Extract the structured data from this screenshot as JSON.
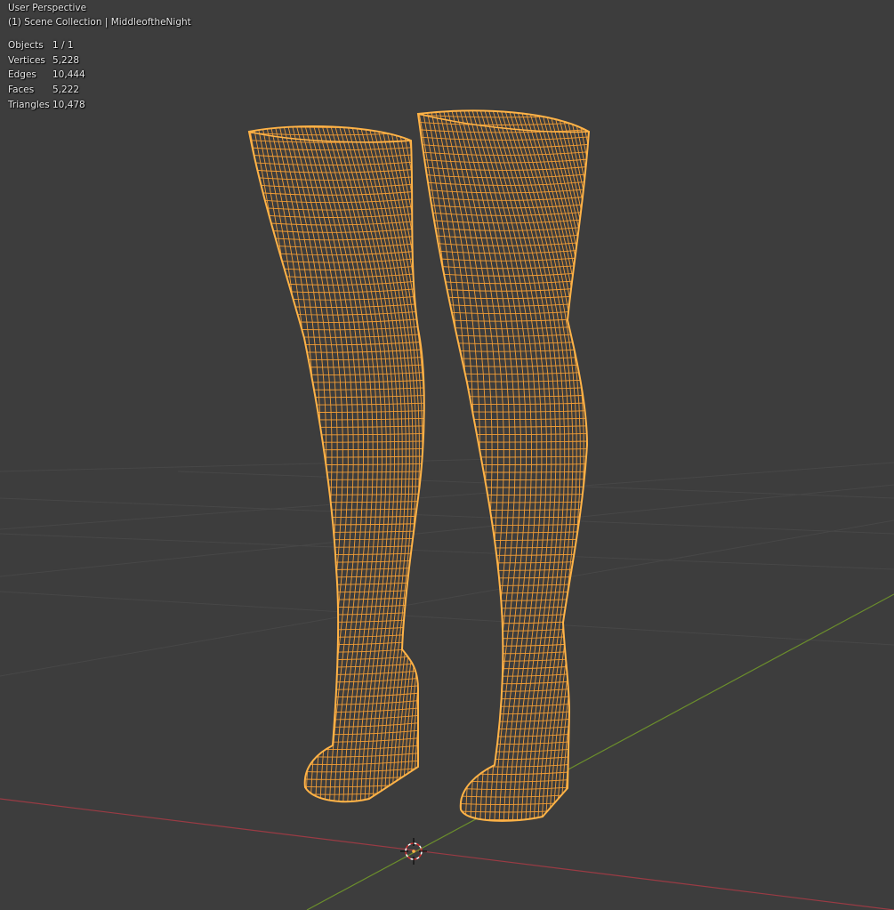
{
  "viewport": {
    "view_name": "User Perspective",
    "collection_label": "(1) Scene Collection | MiddleoftheNight"
  },
  "stats": [
    {
      "label": "Objects",
      "value": "1 / 1"
    },
    {
      "label": "Vertices",
      "value": "5,228"
    },
    {
      "label": "Edges",
      "value": "10,444"
    },
    {
      "label": "Faces",
      "value": "5,222"
    },
    {
      "label": "Triangles",
      "value": "10,478"
    }
  ],
  "colors": {
    "background": "#3d3d3d",
    "grid_line": "#4a4a4a",
    "x_axis": "#9a3b44",
    "y_axis": "#6b8e2c",
    "wireframe": "#f29d35",
    "wireframe_outline": "#ffb347"
  },
  "icons": {
    "origin": "3d-cursor-icon"
  }
}
